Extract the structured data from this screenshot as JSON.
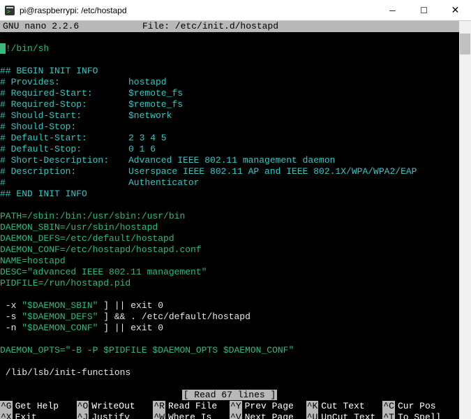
{
  "window": {
    "title": "pi@raspberrypi: /etc/hostapd"
  },
  "nano": {
    "version": "GNU nano 2.2.6",
    "file_label": "File: /etc/init.d/hostapd",
    "status": "[ Read 67 lines ]"
  },
  "file": {
    "shebang": "!/bin/sh",
    "begin": "## BEGIN INIT INFO",
    "provides_k": "# Provides:",
    "provides_v": "hostapd",
    "reqstart_k": "# Required-Start:",
    "reqstart_v": "$remote_fs",
    "reqstop_k": "# Required-Stop:",
    "reqstop_v": "$remote_fs",
    "shstart_k": "# Should-Start:",
    "shstart_v": "$network",
    "shstop_k": "# Should-Stop:",
    "defstart_k": "# Default-Start:",
    "defstart_v": "2 3 4 5",
    "defstop_k": "# Default-Stop:",
    "defstop_v": "0 1 6",
    "shortdesc_k": "# Short-Description:",
    "shortdesc_v": "Advanced IEEE 802.11 management daemon",
    "desc_k": "# Description:",
    "desc_v": "Userspace IEEE 802.11 AP and IEEE 802.1X/WPA/WPA2/EAP",
    "desc_v2": "Authenticator",
    "end": "## END INIT INFO",
    "path": "PATH=/sbin:/bin:/usr/sbin:/usr/bin",
    "dsbin": "DAEMON_SBIN=/usr/sbin/hostapd",
    "ddefs": "DAEMON_DEFS=/etc/default/hostapd",
    "dconf": "DAEMON_CONF=/etc/hostapd/hostapd.conf",
    "name": "NAME=hostapd",
    "desc": "DESC=\"advanced IEEE 802.11 management\"",
    "pidfile": "PIDFILE=/run/hostapd.pid",
    "test1a": " -x ",
    "test1b": "\"$DAEMON_SBIN\"",
    "test1c": " ] || exit 0",
    "test2a": " -s ",
    "test2b": "\"$DAEMON_DEFS\"",
    "test2c": " ] && . /etc/default/hostapd",
    "test3a": " -n ",
    "test3b": "\"$DAEMON_CONF\"",
    "test3c": " ] || exit 0",
    "dopts": "DAEMON_OPTS=\"-B -P $PIDFILE $DAEMON_OPTS $DAEMON_CONF\"",
    "initfn": " /lib/lsb/init-functions"
  },
  "shortcuts": {
    "r1": [
      {
        "k": "^G",
        "l": "Get Help"
      },
      {
        "k": "^O",
        "l": "WriteOut"
      },
      {
        "k": "^R",
        "l": "Read File"
      },
      {
        "k": "^Y",
        "l": "Prev Page"
      },
      {
        "k": "^K",
        "l": "Cut Text"
      },
      {
        "k": "^C",
        "l": "Cur Pos"
      }
    ],
    "r2": [
      {
        "k": "^X",
        "l": "Exit"
      },
      {
        "k": "^J",
        "l": "Justify"
      },
      {
        "k": "^W",
        "l": "Where Is"
      },
      {
        "k": "^V",
        "l": "Next Page"
      },
      {
        "k": "^U",
        "l": "UnCut Text"
      },
      {
        "k": "^T",
        "l": "To Spell"
      }
    ]
  }
}
